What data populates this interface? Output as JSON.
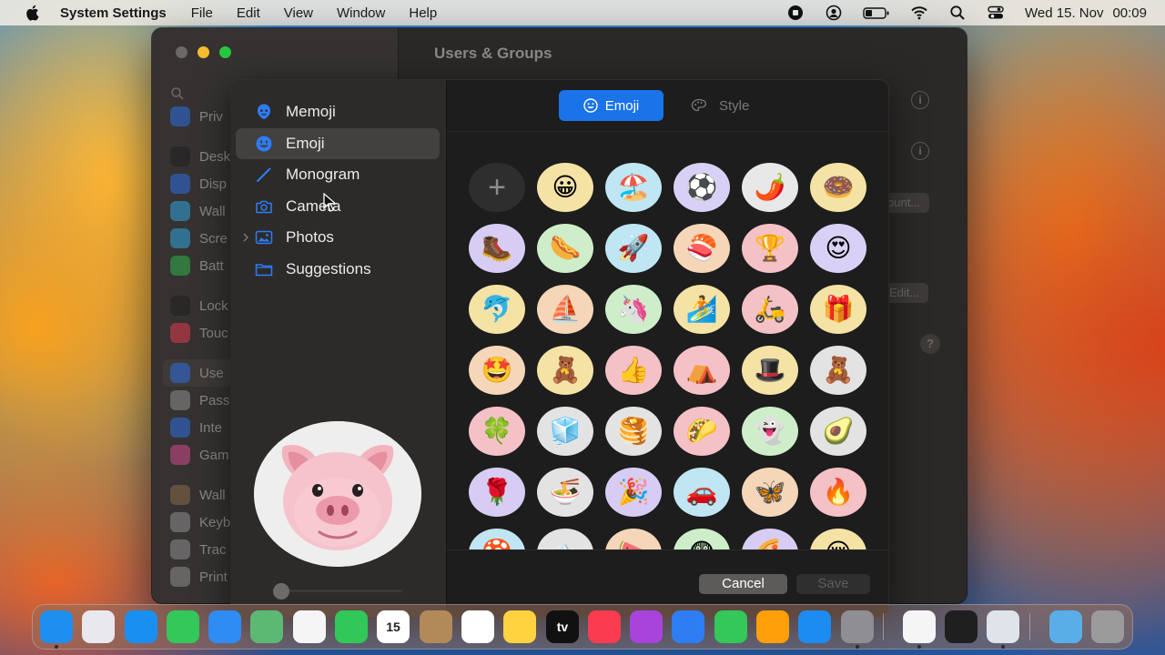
{
  "menubar": {
    "app_name": "System Settings",
    "menus": [
      "File",
      "Edit",
      "View",
      "Window",
      "Help"
    ],
    "date": "Wed 15. Nov",
    "time": "00:09",
    "status_icons": [
      "record-icon",
      "user-icon",
      "battery-icon",
      "wifi-icon",
      "search-icon",
      "control-center-icon"
    ]
  },
  "window": {
    "title": "Users & Groups",
    "sidebar_items": [
      {
        "label": "Priv",
        "color": "#2d6ee0"
      },
      {
        "label": "Desk",
        "color": "#1f1f1f"
      },
      {
        "label": "Disp",
        "color": "#2d6ee0"
      },
      {
        "label": "Wall",
        "color": "#30a4dd"
      },
      {
        "label": "Scre",
        "color": "#30a4dd"
      },
      {
        "label": "Batt",
        "color": "#2fb34a"
      },
      {
        "label": "Lock",
        "color": "#1f1f1f"
      },
      {
        "label": "Touc",
        "color": "#e23b4c"
      },
      {
        "label": "Use",
        "color": "#2d6ee0"
      },
      {
        "label": "Pass",
        "color": "#8e8e8e"
      },
      {
        "label": "Inte",
        "color": "#2d6ee0"
      },
      {
        "label": "Gam",
        "color": "#d04a8a"
      },
      {
        "label": "Wall",
        "color": "#8b6a4a"
      },
      {
        "label": "Keyb",
        "color": "#8e8e8e"
      },
      {
        "label": "Trac",
        "color": "#8e8e8e"
      },
      {
        "label": "Print",
        "color": "#8e8e8e"
      }
    ],
    "account_button": "ount...",
    "edit_button": "Edit..."
  },
  "sheet": {
    "sidebar": [
      {
        "label": "Memoji",
        "icon": "memoji-icon"
      },
      {
        "label": "Emoji",
        "icon": "emoji-icon",
        "selected": true
      },
      {
        "label": "Monogram",
        "icon": "pencil-icon"
      },
      {
        "label": "Camera",
        "icon": "camera-icon"
      },
      {
        "label": "Photos",
        "icon": "photos-icon"
      },
      {
        "label": "Suggestions",
        "icon": "folder-icon"
      }
    ],
    "segments": {
      "emoji": "Emoji",
      "style": "Style"
    },
    "add_label": "+",
    "emoji_grid": [
      {
        "emoji": "😀",
        "bg": "#f5e3a5"
      },
      {
        "emoji": "🏖️",
        "bg": "#bfe6f2"
      },
      {
        "emoji": "⚽",
        "bg": "#d9d1f5"
      },
      {
        "emoji": "🌶️",
        "bg": "#e8e8e8"
      },
      {
        "emoji": "🍩",
        "bg": "#f5e3a5"
      },
      {
        "emoji": "🥾",
        "bg": "#d7ccf3"
      },
      {
        "emoji": "🌭",
        "bg": "#cdeec9"
      },
      {
        "emoji": "🚀",
        "bg": "#bfe6f2"
      },
      {
        "emoji": "🍣",
        "bg": "#f6d6b8"
      },
      {
        "emoji": "🏆",
        "bg": "#f4c1c6"
      },
      {
        "emoji": "😍",
        "bg": "#d9d1f5"
      },
      {
        "emoji": "🐬",
        "bg": "#f5e3a5"
      },
      {
        "emoji": "⛵",
        "bg": "#f6d6b8"
      },
      {
        "emoji": "🦄",
        "bg": "#cdeec9"
      },
      {
        "emoji": "🏄",
        "bg": "#f5e3a5"
      },
      {
        "emoji": "🛵",
        "bg": "#f4c1c6"
      },
      {
        "emoji": "🎁",
        "bg": "#f5e3a5"
      },
      {
        "emoji": "🤩",
        "bg": "#f6d6b8"
      },
      {
        "emoji": "🧸",
        "bg": "#f5e3a5"
      },
      {
        "emoji": "👍",
        "bg": "#f4c1c6"
      },
      {
        "emoji": "⛺",
        "bg": "#f4c1c6"
      },
      {
        "emoji": "🎩",
        "bg": "#f5e3a5"
      },
      {
        "emoji": "🧸",
        "bg": "#e3e3e3"
      },
      {
        "emoji": "🍀",
        "bg": "#f4c1c6"
      },
      {
        "emoji": "🧊",
        "bg": "#e3e3e3"
      },
      {
        "emoji": "🥞",
        "bg": "#e3e3e3"
      },
      {
        "emoji": "🌮",
        "bg": "#f4c1c6"
      },
      {
        "emoji": "👻",
        "bg": "#cdeec9"
      },
      {
        "emoji": "🥑",
        "bg": "#e3e3e3"
      },
      {
        "emoji": "🌹",
        "bg": "#d7ccf3"
      },
      {
        "emoji": "🍜",
        "bg": "#e3e3e3"
      },
      {
        "emoji": "🎉",
        "bg": "#d7ccf3"
      },
      {
        "emoji": "🚗",
        "bg": "#bfe6f2"
      },
      {
        "emoji": "🦋",
        "bg": "#f6d6b8"
      },
      {
        "emoji": "🔥",
        "bg": "#f4c1c6"
      },
      {
        "emoji": "🍄",
        "bg": "#bfe6f2"
      },
      {
        "emoji": "🏔️",
        "bg": "#e3e3e3"
      },
      {
        "emoji": "🍉",
        "bg": "#f6d6b8"
      },
      {
        "emoji": "😨",
        "bg": "#cdeec9"
      },
      {
        "emoji": "🍕",
        "bg": "#d7ccf3"
      },
      {
        "emoji": "😢",
        "bg": "#f5e3a5"
      }
    ],
    "cancel": "Cancel",
    "save": "Save"
  },
  "dock": [
    {
      "name": "finder",
      "bg": "#1e8ff0",
      "label": "",
      "running": true
    },
    {
      "name": "launchpad",
      "bg": "#e8e8ee",
      "label": "",
      "running": false
    },
    {
      "name": "safari",
      "bg": "#1a8ff2",
      "label": "",
      "running": false
    },
    {
      "name": "messages",
      "bg": "#34c759",
      "label": "",
      "running": false
    },
    {
      "name": "mail",
      "bg": "#2f8cf4",
      "label": "",
      "running": false
    },
    {
      "name": "maps",
      "bg": "#5bb974",
      "label": "",
      "running": false
    },
    {
      "name": "photos",
      "bg": "#f5f5f5",
      "label": "",
      "running": false
    },
    {
      "name": "facetime",
      "bg": "#31c759",
      "label": "",
      "running": false
    },
    {
      "name": "calendar",
      "bg": "#ffffff",
      "label": "15",
      "running": false
    },
    {
      "name": "contacts",
      "bg": "#b28a5a",
      "label": "",
      "running": false
    },
    {
      "name": "reminders",
      "bg": "#ffffff",
      "label": "",
      "running": false
    },
    {
      "name": "notes",
      "bg": "#ffd23f",
      "label": "",
      "running": false
    },
    {
      "name": "tv",
      "bg": "#111111",
      "label": "tv",
      "running": false
    },
    {
      "name": "music",
      "bg": "#fb3c50",
      "label": "",
      "running": false
    },
    {
      "name": "podcasts",
      "bg": "#a844dc",
      "label": "",
      "running": false
    },
    {
      "name": "keynote",
      "bg": "#2f7df3",
      "label": "",
      "running": false
    },
    {
      "name": "numbers",
      "bg": "#34c759",
      "label": "",
      "running": false
    },
    {
      "name": "pages",
      "bg": "#ff9f0a",
      "label": "",
      "running": false
    },
    {
      "name": "app-store",
      "bg": "#1c8cf3",
      "label": "",
      "running": false
    },
    {
      "name": "system-settings",
      "bg": "#8e8e93",
      "label": "",
      "running": true
    },
    {
      "name": "chrome",
      "bg": "#f5f5f5",
      "label": "",
      "running": true
    },
    {
      "name": "activity-monitor",
      "bg": "#1f1f1f",
      "label": "",
      "running": false
    },
    {
      "name": "quicktime",
      "bg": "#dfe3ea",
      "label": "",
      "running": true
    },
    {
      "name": "downloads",
      "bg": "#5aaee8",
      "label": "",
      "running": false
    },
    {
      "name": "trash",
      "bg": "#9b9b9b",
      "label": "",
      "running": false
    }
  ]
}
